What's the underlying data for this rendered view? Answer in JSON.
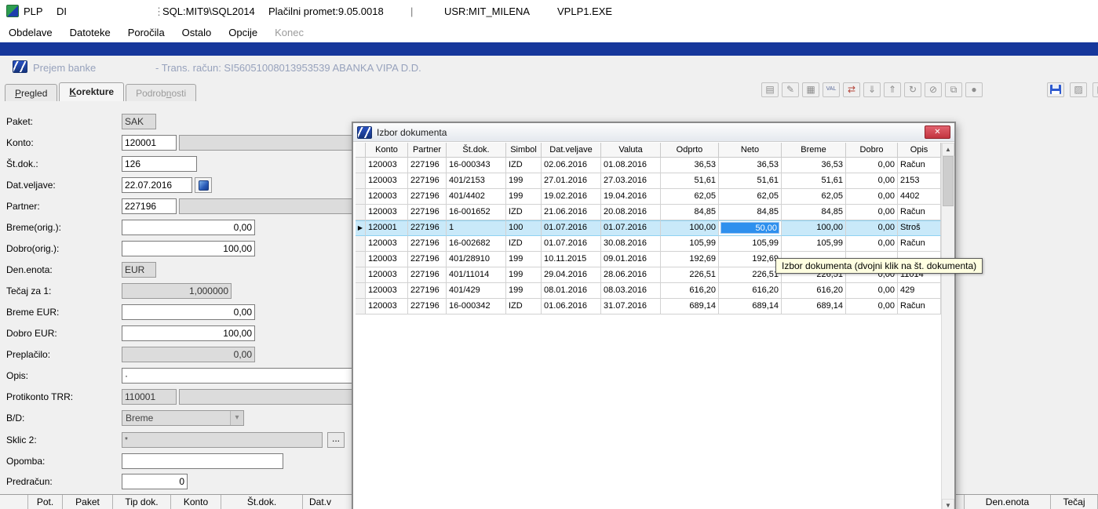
{
  "icons": {
    "close": "✕",
    "scroll_up": "▲",
    "scroll_down": "▼",
    "row_marker": "▶",
    "dropdown_arrow": "▾",
    "ellipsis": "...",
    "window_marker": "▫"
  },
  "titlebar": {
    "app_title": "PLP",
    "app_mode": "DI",
    "separator": "⋮",
    "sql_info": "SQL:MIT9\\SQL2014",
    "module_info": "Plačilni promet:9.05.0018",
    "pipe": "|",
    "user_info": "USR:MIT_MILENA",
    "exe_name": "VPLP1.EXE"
  },
  "menubar": {
    "items": [
      {
        "label": "Obdelave",
        "enabled": true
      },
      {
        "label": "Datoteke",
        "enabled": true
      },
      {
        "label": "Poročila",
        "enabled": true
      },
      {
        "label": "Ostalo",
        "enabled": true
      },
      {
        "label": "Opcije",
        "enabled": true
      },
      {
        "label": "Konec",
        "enabled": false
      }
    ]
  },
  "window_header": {
    "title": "Prejem banke",
    "subtitle": "- Trans. račun: SI56051008013953539  ABANKA VIPA D.D."
  },
  "tabs": [
    {
      "label": "Pregled",
      "accel": 0,
      "active": false,
      "enabled": true
    },
    {
      "label": "Korekture",
      "accel": 0,
      "active": true,
      "enabled": true
    },
    {
      "label": "Podrobnosti",
      "accel": 6,
      "active": false,
      "enabled": false
    }
  ],
  "toolbar": {
    "buttons": [
      {
        "name": "report-icon",
        "glyph": "▤"
      },
      {
        "name": "edit-icon",
        "glyph": "✎"
      },
      {
        "name": "grid-icon",
        "glyph": "▦"
      },
      {
        "name": "valuta-icon",
        "glyph": "VAL",
        "small": true,
        "color": "#5a6b9a"
      },
      {
        "name": "transfer-icon",
        "glyph": "⇄",
        "color": "#b4453a"
      },
      {
        "name": "import-icon",
        "glyph": "⇓"
      },
      {
        "name": "export-icon",
        "glyph": "⇑"
      },
      {
        "name": "refresh-icon",
        "glyph": "↻"
      },
      {
        "name": "attachment-icon",
        "glyph": "⊘"
      },
      {
        "name": "windows-icon",
        "glyph": "⧉"
      },
      {
        "name": "record-icon",
        "glyph": "●"
      }
    ],
    "right_buttons": [
      {
        "name": "save-icon",
        "style": "floppy"
      },
      {
        "name": "open-icon",
        "glyph": "▨"
      },
      {
        "name": "print-icon",
        "glyph": "▤"
      }
    ]
  },
  "form": {
    "paket": {
      "label": "Paket:",
      "value": "SAK"
    },
    "konto": {
      "label": "Konto:",
      "value": "120001",
      "desc": ""
    },
    "st_dok": {
      "label": "Št.dok.:",
      "value": "126"
    },
    "dat_veljave": {
      "label": "Dat.veljave:",
      "value": "22.07.2016"
    },
    "partner": {
      "label": "Partner:",
      "value": "227196",
      "desc": ""
    },
    "breme_orig": {
      "label": "Breme(orig.):",
      "value": "0,00"
    },
    "dobro_orig": {
      "label": "Dobro(orig.):",
      "value": "100,00"
    },
    "den_enota": {
      "label": "Den.enota:",
      "value": "EUR"
    },
    "tecaj": {
      "label": "Tečaj za 1:",
      "value": "1,000000"
    },
    "breme_eur": {
      "label": "Breme EUR:",
      "value": "0,00"
    },
    "dobro_eur": {
      "label": "Dobro EUR:",
      "value": "100,00"
    },
    "preplacilo": {
      "label": "Preplačilo:",
      "value": "0,00"
    },
    "opis": {
      "label": "Opis:",
      "value": "·"
    },
    "protikonto": {
      "label": "Protikonto TRR:",
      "value": "110001",
      "desc": ""
    },
    "bd": {
      "label": "B/D:",
      "value": "Breme"
    },
    "sklic2": {
      "label": "Sklic 2:",
      "value": "*"
    },
    "opomba": {
      "label": "Opomba:",
      "value": ""
    },
    "predracun": {
      "label": "Predračun:",
      "value": "0"
    }
  },
  "dialog": {
    "title": "Izbor dokumenta",
    "tooltip": "Izbor dokumenta (dvojni klik na št. dokumenta)",
    "columns": [
      "Konto",
      "Partner",
      "Št.dok.",
      "Simbol",
      "Dat.veljave",
      "Valuta",
      "Odprto",
      "Neto",
      "Breme",
      "Dobro",
      "Opis"
    ],
    "rows": [
      {
        "cells": [
          "120003",
          "227196",
          "16-000343",
          "IZD",
          "02.06.2016",
          "01.08.2016",
          "36,53",
          "36,53",
          "36,53",
          "0,00",
          "Račun"
        ]
      },
      {
        "cells": [
          "120003",
          "227196",
          "401/2153",
          "199",
          "27.01.2016",
          "27.03.2016",
          "51,61",
          "51,61",
          "51,61",
          "0,00",
          "2153"
        ]
      },
      {
        "cells": [
          "120003",
          "227196",
          "401/4402",
          "199",
          "19.02.2016",
          "19.04.2016",
          "62,05",
          "62,05",
          "62,05",
          "0,00",
          "4402"
        ]
      },
      {
        "cells": [
          "120003",
          "227196",
          "16-001652",
          "IZD",
          "21.06.2016",
          "20.08.2016",
          "84,85",
          "84,85",
          "84,85",
          "0,00",
          "Račun"
        ]
      },
      {
        "cells": [
          "120001",
          "227196",
          "1",
          "100",
          "01.07.2016",
          "01.07.2016",
          "100,00",
          "50,00",
          "100,00",
          "0,00",
          "Stroš"
        ],
        "selected": true,
        "editing_col": 7
      },
      {
        "cells": [
          "120003",
          "227196",
          "16-002682",
          "IZD",
          "01.07.2016",
          "30.08.2016",
          "105,99",
          "105,99",
          "105,99",
          "0,00",
          "Račun"
        ]
      },
      {
        "cells": [
          "120003",
          "227196",
          "401/28910",
          "199",
          "10.11.2015",
          "09.01.2016",
          "192,69",
          "192,69",
          "",
          "",
          ""
        ]
      },
      {
        "cells": [
          "120003",
          "227196",
          "401/11014",
          "199",
          "29.04.2016",
          "28.06.2016",
          "226,51",
          "226,51",
          "226,51",
          "0,00",
          "11014"
        ]
      },
      {
        "cells": [
          "120003",
          "227196",
          "401/429",
          "199",
          "08.01.2016",
          "08.03.2016",
          "616,20",
          "616,20",
          "616,20",
          "0,00",
          "429"
        ]
      },
      {
        "cells": [
          "120003",
          "227196",
          "16-000342",
          "IZD",
          "01.06.2016",
          "31.07.2016",
          "689,14",
          "689,14",
          "689,14",
          "0,00",
          "Račun"
        ]
      }
    ]
  },
  "bottom_grid": {
    "left_columns": [
      "Pot.",
      "Paket",
      "Tip dok.",
      "Konto",
      "Št.dok.",
      "Dat.v"
    ],
    "right_columns": [
      "Den.enota",
      "Tečaj"
    ]
  }
}
